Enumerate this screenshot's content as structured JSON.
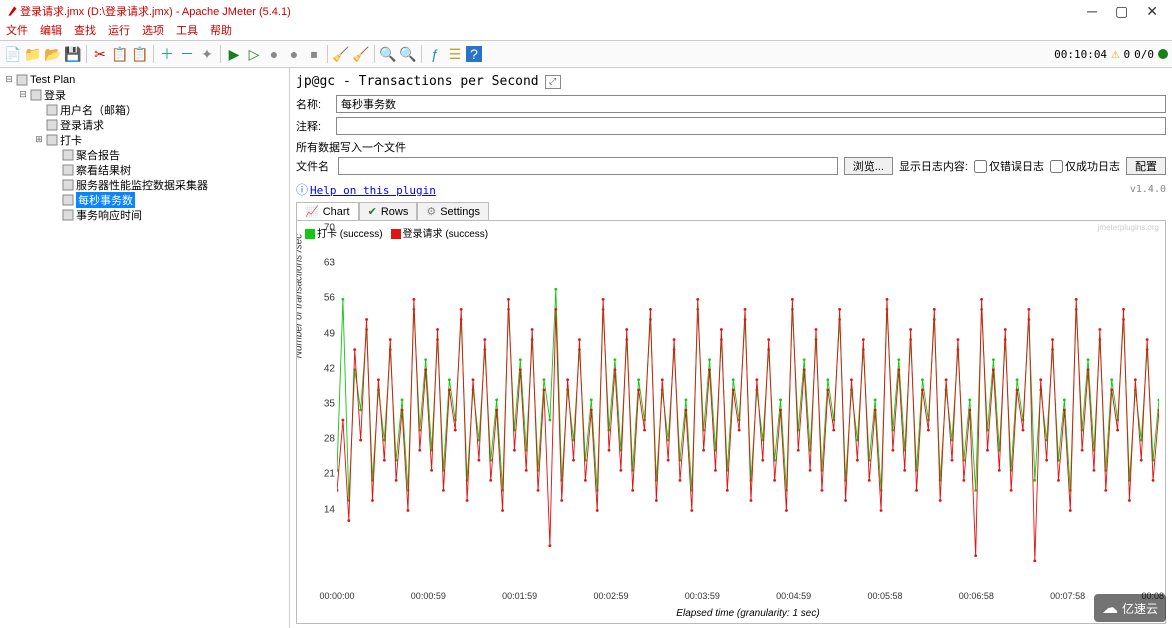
{
  "window": {
    "title": "登录请求.jmx (D:\\登录请求.jmx) - Apache JMeter (5.4.1)"
  },
  "menu": {
    "items": [
      "文件",
      "编辑",
      "查找",
      "运行",
      "选项",
      "工具",
      "帮助"
    ]
  },
  "toolbar_icons": {
    "new": "📄",
    "tpl": "📁",
    "open": "📂",
    "save": "💾",
    "cut": "✂",
    "copy": "📋",
    "paste": "📋",
    "plus": "＋",
    "minus": "－",
    "wand": "✦",
    "run": "▶",
    "run_no": "▷",
    "stop": "●",
    "stop2": "●",
    "shutdown": "⏹",
    "broom": "🧹",
    "broom2": "🧹",
    "search": "🔍",
    "func": "ƒ",
    "list": "☰",
    "help": "?"
  },
  "toolbar_timer": {
    "elapsed": "00:10:04",
    "errors": "0",
    "ratio": "0/0"
  },
  "tree": {
    "items": [
      {
        "label": "Test Plan",
        "level": 0,
        "expand": "⊟"
      },
      {
        "label": "登录",
        "level": 1,
        "expand": "⊟"
      },
      {
        "label": "用户名（邮箱）",
        "level": 2
      },
      {
        "label": "登录请求",
        "level": 2
      },
      {
        "label": "打卡",
        "level": 2,
        "expand": "⊞"
      },
      {
        "label": "聚合报告",
        "level": 3
      },
      {
        "label": "察看结果树",
        "level": 3
      },
      {
        "label": "服务器性能监控数据采集器",
        "level": 3
      },
      {
        "label": "每秒事务数",
        "level": 3,
        "selected": true
      },
      {
        "label": "事务响应时间",
        "level": 3
      }
    ]
  },
  "panel": {
    "title": "jp@gc - Transactions per Second",
    "labels": {
      "name": "名称:",
      "comment": "注释:",
      "write_all": "所有数据写入一个文件",
      "filename": "文件名",
      "browse": "浏览...",
      "log_display": "显示日志内容:",
      "only_err": "仅错误日志",
      "only_ok": "仅成功日志",
      "config": "配置"
    },
    "values": {
      "name": "每秒事务数",
      "comment": "",
      "filename": ""
    },
    "help": {
      "text": "Help on this plugin",
      "version": "v1.4.0"
    },
    "tabs": {
      "chart": "Chart",
      "rows": "Rows",
      "settings": "Settings"
    }
  },
  "logo": {
    "text": "亿速云"
  },
  "chart_data": {
    "type": "line",
    "title": "",
    "ylabel": "Number of transactions /sec",
    "xlabel": "Elapsed time (granularity: 1 sec)",
    "ylim": [
      0,
      70
    ],
    "y_ticks": [
      14,
      21,
      28,
      35,
      42,
      49,
      56,
      63,
      70
    ],
    "x_ticks": [
      "00:00:00",
      "00:00:59",
      "00:01:59",
      "00:02:59",
      "00:03:59",
      "00:04:59",
      "00:05:58",
      "00:06:58",
      "00:07:58",
      "00:08:58"
    ],
    "watermark": "jmeterplugins.org",
    "series": [
      {
        "name": "打卡 (success)",
        "color": "#14c814",
        "values": [
          24,
          58,
          18,
          44,
          36,
          52,
          22,
          40,
          30,
          48,
          26,
          38,
          20,
          56,
          32,
          46,
          28,
          50,
          24,
          42,
          34,
          54,
          22,
          40,
          30,
          48,
          26,
          38,
          20,
          56,
          32,
          46,
          28,
          50,
          24,
          42,
          34,
          60,
          22,
          40,
          30,
          48,
          26,
          38,
          20,
          56,
          32,
          46,
          28,
          50,
          24,
          42,
          34,
          54,
          22,
          40,
          30,
          48,
          26,
          38,
          20,
          56,
          32,
          46,
          28,
          50,
          24,
          42,
          34,
          54,
          22,
          40,
          30,
          48,
          26,
          38,
          20,
          56,
          32,
          46,
          28,
          50,
          24,
          42,
          34,
          54,
          22,
          40,
          30,
          48,
          26,
          38,
          20,
          56,
          32,
          46,
          28,
          50,
          24,
          42,
          34,
          54,
          22,
          40,
          30,
          48,
          26,
          38,
          20,
          56,
          32,
          46,
          28,
          50,
          24,
          42,
          34,
          54,
          22,
          40,
          30,
          48,
          26,
          38,
          20,
          56,
          32,
          46,
          28,
          50,
          24,
          42,
          34,
          54,
          22,
          40,
          30,
          48,
          26,
          38
        ]
      },
      {
        "name": "登录请求 (success)",
        "color": "#e11414",
        "values": [
          20,
          34,
          14,
          48,
          30,
          54,
          18,
          42,
          26,
          50,
          22,
          36,
          16,
          58,
          28,
          44,
          24,
          52,
          20,
          40,
          32,
          56,
          18,
          42,
          26,
          50,
          22,
          36,
          16,
          58,
          28,
          44,
          24,
          52,
          20,
          40,
          9,
          56,
          18,
          42,
          26,
          50,
          22,
          36,
          16,
          58,
          28,
          44,
          24,
          52,
          20,
          40,
          32,
          56,
          18,
          42,
          26,
          50,
          22,
          36,
          16,
          58,
          28,
          44,
          24,
          52,
          20,
          40,
          32,
          56,
          18,
          42,
          26,
          50,
          22,
          36,
          16,
          58,
          28,
          44,
          24,
          52,
          20,
          40,
          32,
          56,
          18,
          42,
          26,
          50,
          22,
          36,
          16,
          58,
          28,
          44,
          24,
          52,
          20,
          40,
          32,
          56,
          18,
          42,
          26,
          50,
          22,
          36,
          7,
          58,
          28,
          44,
          24,
          52,
          20,
          40,
          32,
          56,
          6,
          42,
          26,
          50,
          22,
          36,
          16,
          58,
          28,
          44,
          24,
          52,
          20,
          40,
          32,
          56,
          18,
          42,
          26,
          50,
          22,
          36
        ]
      }
    ]
  }
}
